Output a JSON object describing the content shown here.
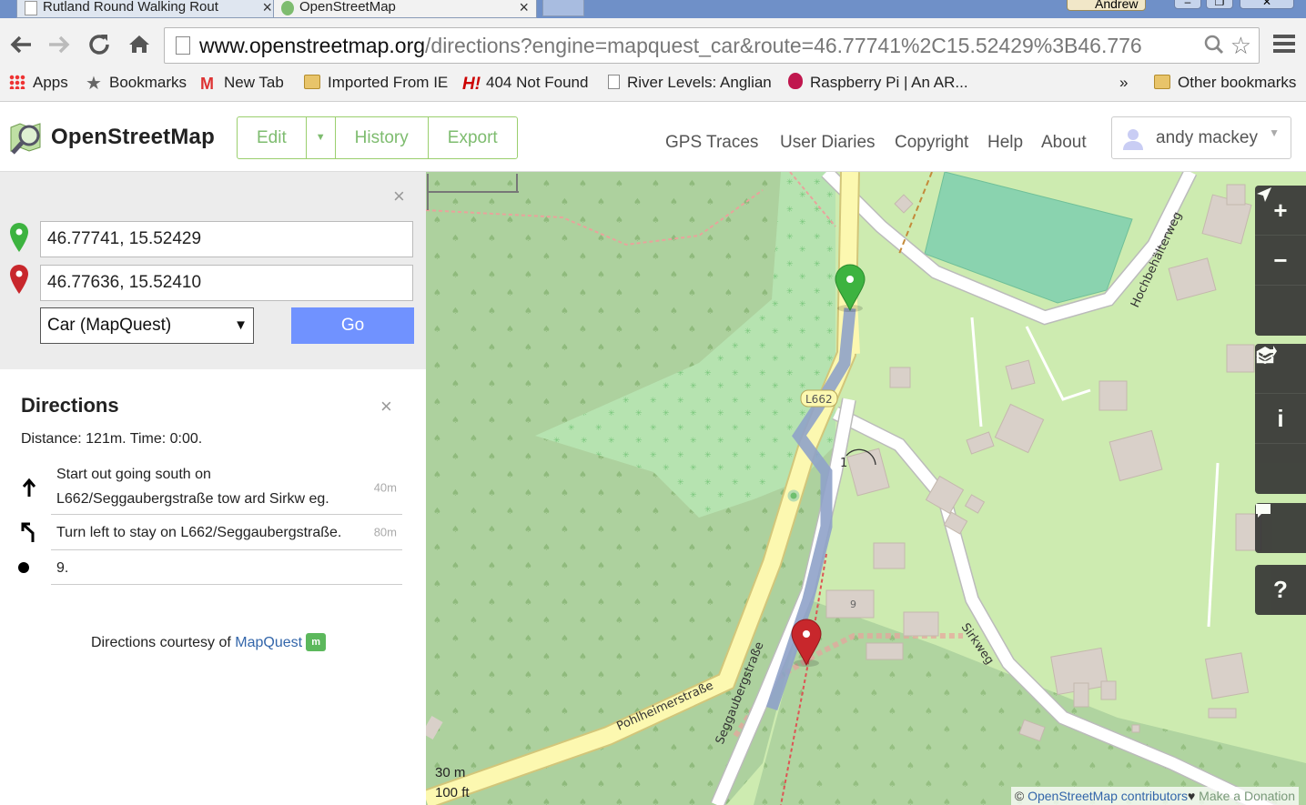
{
  "browser": {
    "tabs": [
      {
        "title": "Rutland Round Walking Rout"
      },
      {
        "title": "OpenStreetMap"
      }
    ],
    "profile_name": "Andrew",
    "url_host": "www.openstreetmap.org",
    "url_path": "/directions?engine=mapquest_car&route=46.77741%2C15.52429%3B46.776",
    "bookmarks": [
      {
        "label": "Apps",
        "icon": "apps-icon"
      },
      {
        "label": "Bookmarks",
        "icon": "star-icon"
      },
      {
        "label": "New Tab",
        "icon": "gmail-icon"
      },
      {
        "label": "Imported From IE",
        "icon": "folder-icon"
      },
      {
        "label": "404 Not Found",
        "icon": "h-icon"
      },
      {
        "label": "River Levels: Anglian",
        "icon": "page-icon"
      },
      {
        "label": "Raspberry Pi | An AR...",
        "icon": "raspberry-icon"
      }
    ],
    "bookmarks_overflow": "»",
    "other_bookmarks": "Other bookmarks"
  },
  "osm": {
    "title": "OpenStreetMap",
    "edit_label": "Edit",
    "history_label": "History",
    "export_label": "Export",
    "links": [
      "GPS Traces",
      "User Diaries",
      "Copyright",
      "Help",
      "About"
    ],
    "user_name": "andy mackey"
  },
  "route_form": {
    "from": "46.77741, 15.52429",
    "to": "46.77636, 15.52410",
    "engine": "Car (MapQuest)",
    "go_label": "Go",
    "close": "×"
  },
  "directions": {
    "title": "Directions",
    "close": "×",
    "summary": "Distance: 121m. Time: 0:00.",
    "steps": [
      {
        "instruction": "Start out going south on L662/Seggaubergstraße tow ard Sirkw eg.",
        "distance": "40m",
        "icon": "arrow-up-icon"
      },
      {
        "instruction": "Turn left to stay on L662/Seggaubergstraße.",
        "distance": "80m",
        "icon": "turn-left-icon"
      },
      {
        "instruction": "9.",
        "distance": "",
        "icon": "dot-icon"
      }
    ],
    "courtesy_prefix": "Directions courtesy of ",
    "courtesy_link": "MapQuest"
  },
  "map": {
    "road_labels": [
      "Pohlheimerstraße",
      "Seggaubergstraße",
      "Sirkweg",
      "Hochbehälterweg",
      "L662"
    ],
    "house_number": "9",
    "scale_metric": "30 m",
    "scale_imperial": "100 ft",
    "attribution_prefix": "© ",
    "attribution_link": "OpenStreetMap contributors",
    "attribution_heart": "♥",
    "attribution_donate": " Make a Donation",
    "controls": [
      "zoom-in",
      "zoom-out",
      "locate",
      "layers",
      "info",
      "share",
      "note",
      "help"
    ],
    "colors": {
      "forest": "#add19e",
      "grass": "#cdebb0",
      "pitch": "#8ad3af",
      "building": "#d9d0c9",
      "primary_road": "#fcf8b0",
      "route": "#a3b5d9",
      "start_pin": "#3db340",
      "end_pin": "#c8272c"
    }
  }
}
